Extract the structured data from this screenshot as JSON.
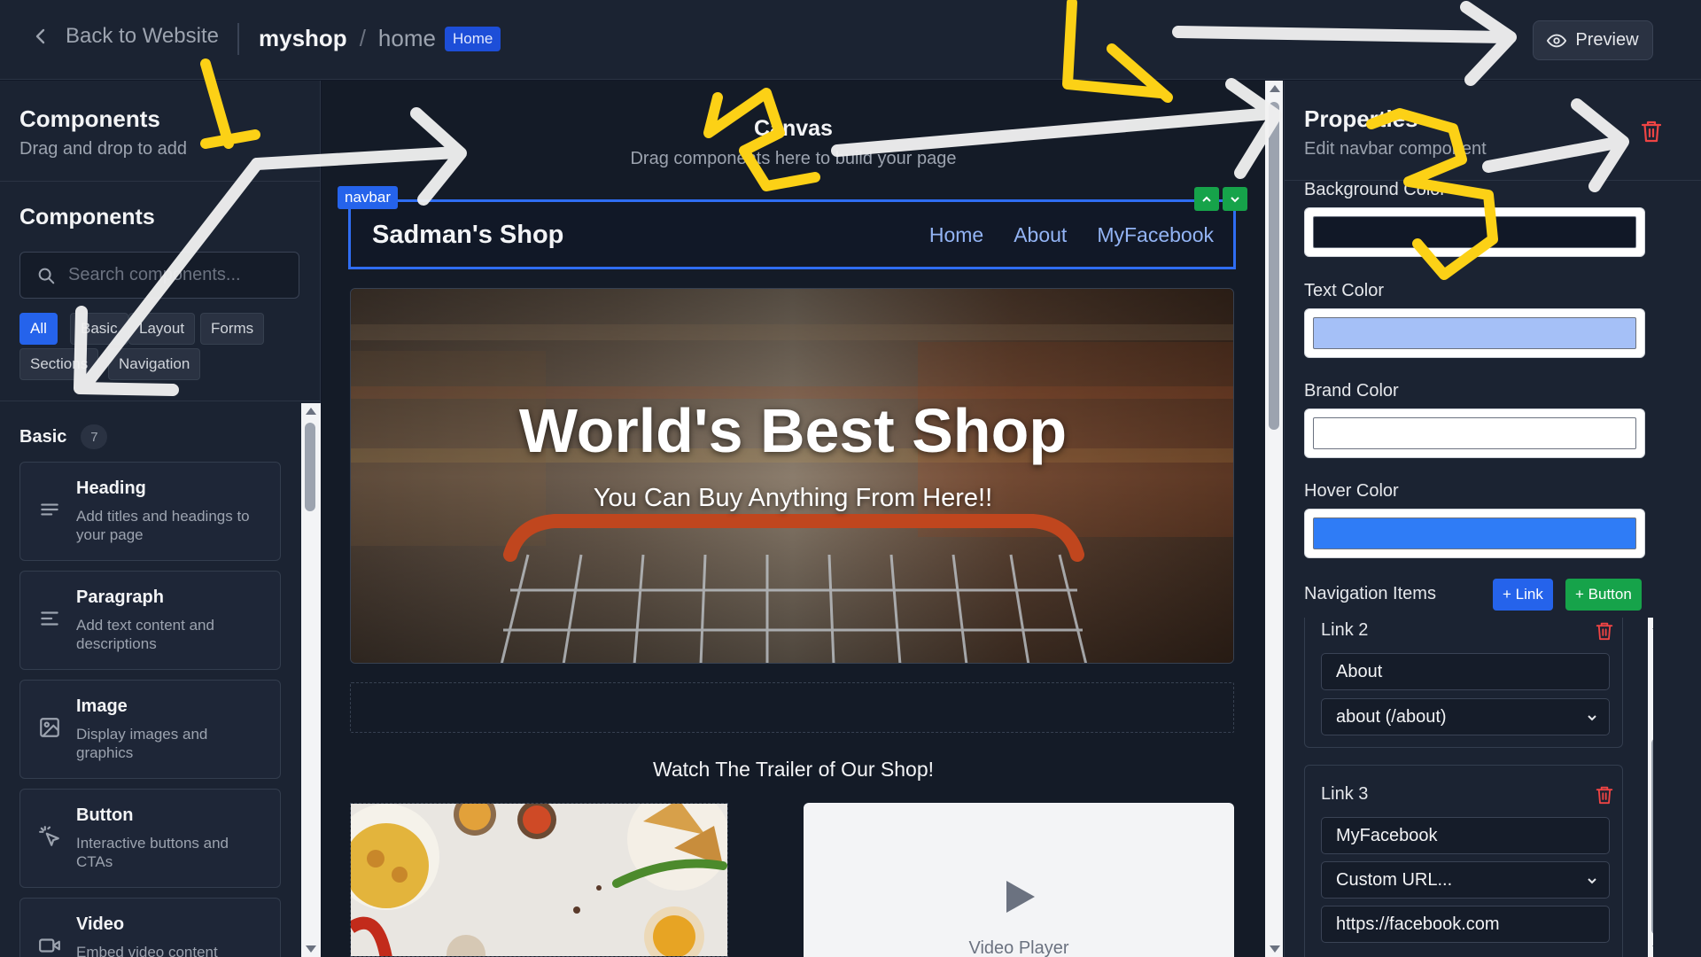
{
  "topbar": {
    "back_label": "Back to Website",
    "shop": "myshop",
    "separator": "/",
    "page": "home",
    "page_badge": "Home",
    "preview_label": "Preview"
  },
  "left": {
    "title": "Components",
    "subtitle": "Drag and drop to add",
    "section_title": "Components",
    "search_placeholder": "Search components...",
    "filters": [
      "All",
      "Basic",
      "Layout",
      "Forms",
      "Sections",
      "Navigation"
    ],
    "active_filter": "All",
    "group_label": "Basic",
    "group_count": "7",
    "cards": [
      {
        "title": "Heading",
        "desc": "Add titles and headings to your page",
        "icon": "heading-icon"
      },
      {
        "title": "Paragraph",
        "desc": "Add text content and descriptions",
        "icon": "paragraph-icon"
      },
      {
        "title": "Image",
        "desc": "Display images and graphics",
        "icon": "image-icon"
      },
      {
        "title": "Button",
        "desc": "Interactive buttons and CTAs",
        "icon": "pointer-icon"
      },
      {
        "title": "Video",
        "desc": "Embed video content",
        "icon": "video-icon"
      }
    ]
  },
  "canvas": {
    "title": "Canvas",
    "subtitle": "Drag components here to build your page",
    "selected_tag": "navbar",
    "navbar": {
      "brand": "Sadman's Shop",
      "links": [
        "Home",
        "About",
        "MyFacebook"
      ]
    },
    "hero": {
      "title": "World's Best Shop",
      "subtitle": "You Can Buy Anything From Here!!"
    },
    "trailer_heading": "Watch The Trailer of Our Shop!",
    "video_label": "Video Player"
  },
  "properties": {
    "title": "Properties",
    "subtitle": "Edit navbar component",
    "fields": [
      {
        "label": "Background Color",
        "color": "#111827"
      },
      {
        "label": "Text Color",
        "color": "#a5c0f7"
      },
      {
        "label": "Brand Color",
        "color": "#ffffff"
      },
      {
        "label": "Hover Color",
        "color": "#2f7cf6"
      }
    ],
    "nav_items_label": "Navigation Items",
    "add_link_label": "+ Link",
    "add_button_label": "+ Button",
    "items": [
      {
        "title": "Link 2",
        "text": "About",
        "select": "about (/about)"
      },
      {
        "title": "Link 3",
        "text": "MyFacebook",
        "select": "Custom URL...",
        "url": "https://facebook.com"
      }
    ]
  },
  "colors": {
    "accent": "#2563eb",
    "success": "#16a34a",
    "danger": "#ef4444",
    "annotation_yellow": "#fcd116"
  }
}
